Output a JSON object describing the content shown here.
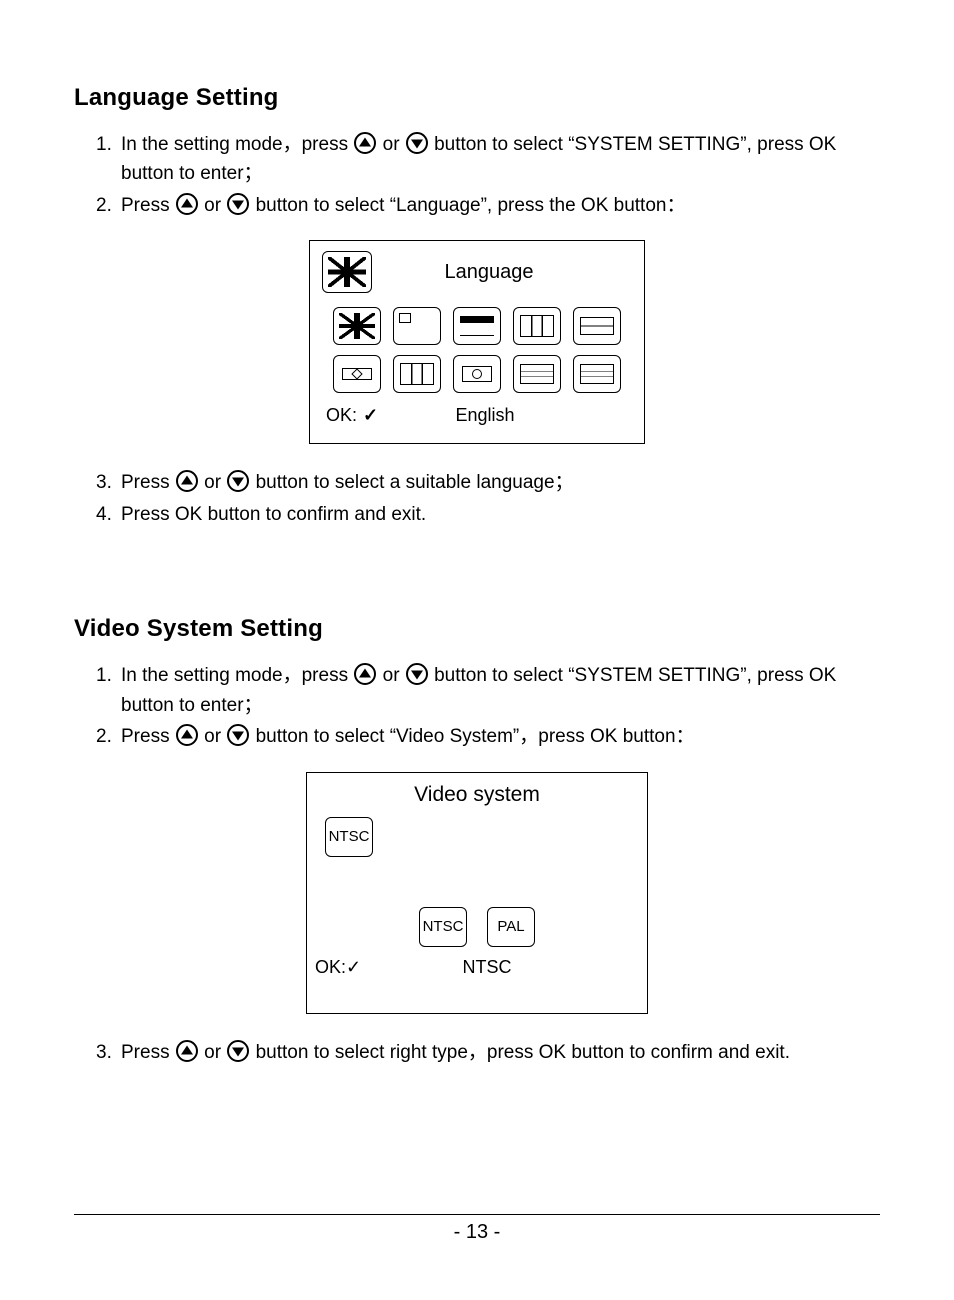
{
  "section1": {
    "heading": "Language Setting",
    "steps": [
      "In the setting mode，press [UP] or [DOWN] button to select “SYSTEM SETTING”, press OK button to enter；",
      "Press [UP] or [DOWN] button to select “Language”, press the OK button：",
      "Press [UP] or [DOWN] button to select a suitable language；",
      "Press OK button to confirm and exit."
    ],
    "screen": {
      "title": "Language",
      "ok_label": "OK:",
      "selected": "English",
      "flags": [
        "uk",
        "jp",
        "de",
        "fr",
        "nl",
        "br",
        "it",
        "pt",
        "es",
        "ru"
      ]
    }
  },
  "section2": {
    "heading": "Video System Setting",
    "steps": [
      "In the setting mode，press [UP] or [DOWN] button to select “SYSTEM SETTING”, press OK button to enter；",
      "Press [UP] or [DOWN] button to select “Video System”，press OK button：",
      "Press [UP] or [DOWN] button to select right type，press OK button to confirm and exit."
    ],
    "screen": {
      "title": "Video system",
      "current_tile": "NTSC",
      "options": [
        "NTSC",
        "PAL"
      ],
      "ok_label": "OK:",
      "selected": "NTSC"
    }
  },
  "page_number": "- 13 -"
}
